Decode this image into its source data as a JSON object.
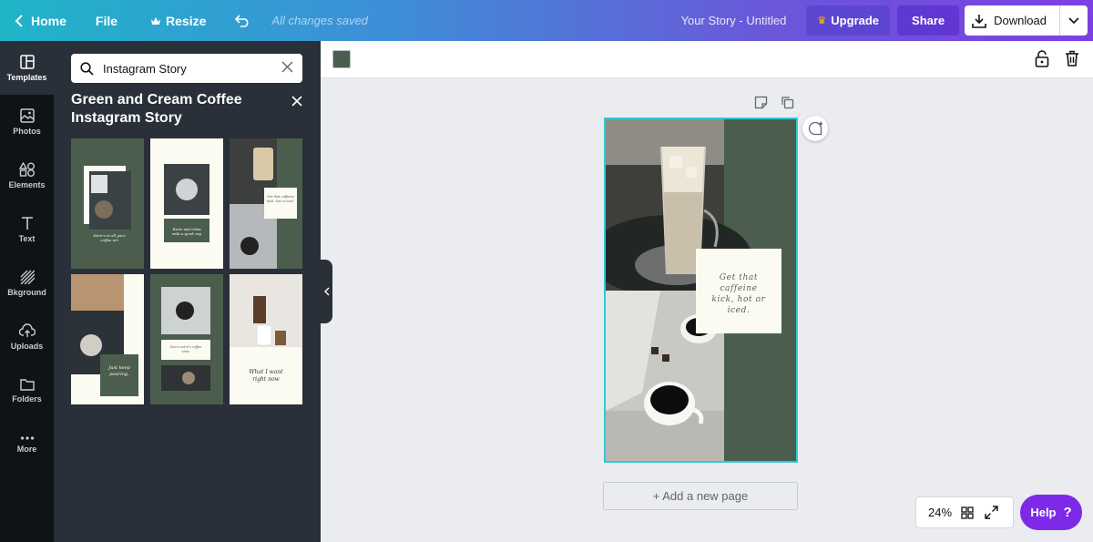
{
  "topbar": {
    "home_label": "Home",
    "file_label": "File",
    "resize_label": "Resize",
    "saved_status": "All changes saved",
    "doc_title": "Your Story - Untitled",
    "upgrade_label": "Upgrade",
    "share_label": "Share",
    "download_label": "Download"
  },
  "rail": {
    "items": [
      {
        "label": "Templates",
        "icon": "templates-icon"
      },
      {
        "label": "Photos",
        "icon": "photos-icon"
      },
      {
        "label": "Elements",
        "icon": "elements-icon"
      },
      {
        "label": "Text",
        "icon": "text-icon"
      },
      {
        "label": "Bkground",
        "icon": "background-icon"
      },
      {
        "label": "Uploads",
        "icon": "uploads-icon"
      },
      {
        "label": "Folders",
        "icon": "folders-icon"
      },
      {
        "label": "More",
        "icon": "more-icon"
      }
    ]
  },
  "panel": {
    "search_value": "Instagram Story",
    "title": "Green and Cream Coffee Instagram Story",
    "thumbs": [
      {
        "caption": "Here's to all your coffee art"
      },
      {
        "caption": "Brew and relax with a good cup"
      },
      {
        "caption": "Get that caffeine kick, hot or iced."
      },
      {
        "caption": "Just keep pouring."
      },
      {
        "caption": "Sun's out it's coffee time"
      },
      {
        "caption": "What I want right now"
      }
    ]
  },
  "canvas": {
    "story_text": "Get that caffeine kick, hot or iced.",
    "add_page_label": "+ Add a new page",
    "background_color": "#4b5e4e"
  },
  "bottom": {
    "zoom": "24%",
    "help_label": "Help",
    "help_icon": "?"
  },
  "colors": {
    "accent_cyan": "#2dcad6",
    "help_purple": "#7d2ae8",
    "story_green": "#4b5e4e",
    "cream": "#fcfbf2"
  }
}
